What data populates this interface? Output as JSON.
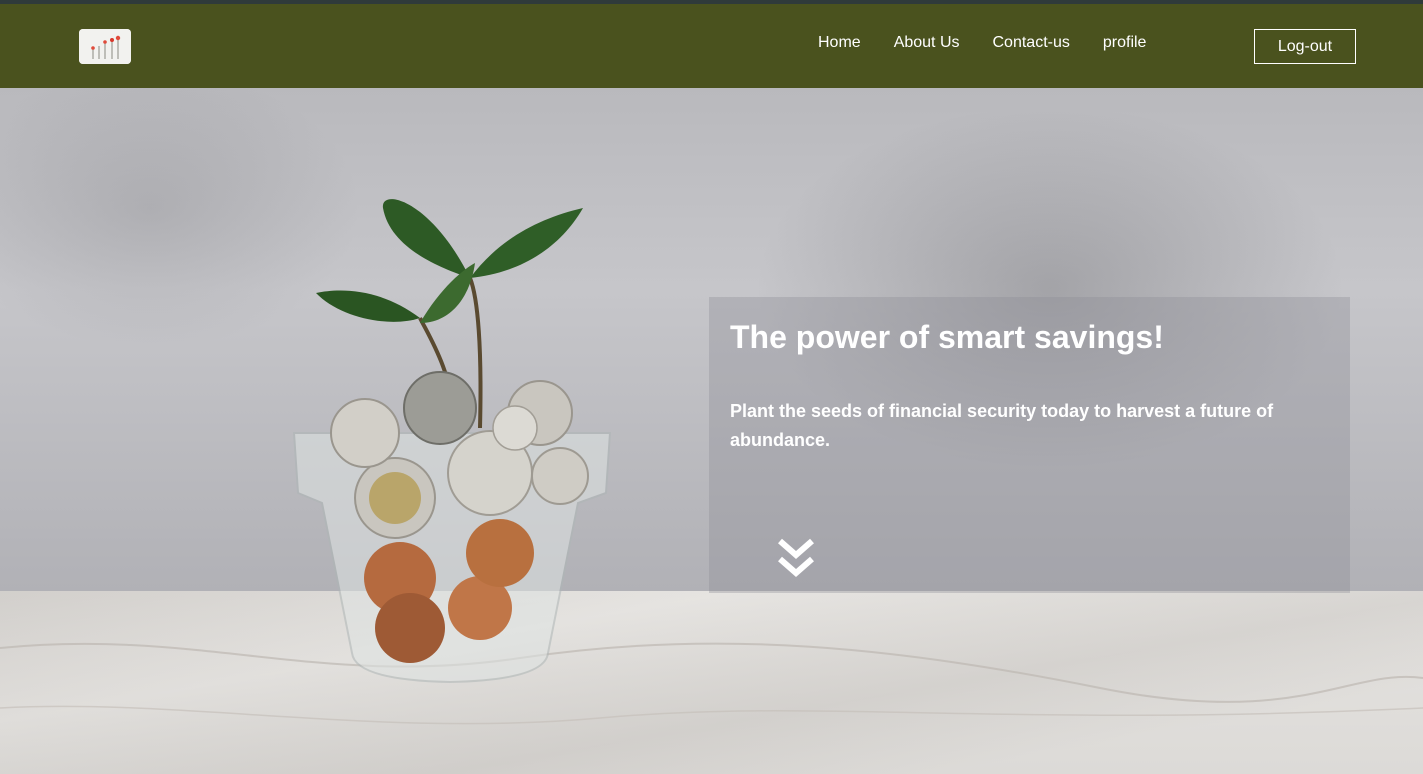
{
  "nav": {
    "links": [
      "Home",
      "About Us",
      "Contact-us",
      "profile"
    ],
    "logout_label": "Log-out"
  },
  "hero": {
    "title": "The power of smart savings!",
    "text": "Plant the seeds of financial security today to harvest a future of abundance.",
    "scroll_icon": "double-chevron-down-icon",
    "image": "plant-in-coin-jar"
  },
  "colors": {
    "navbar": "#4a521e",
    "text": "#ffffff"
  }
}
